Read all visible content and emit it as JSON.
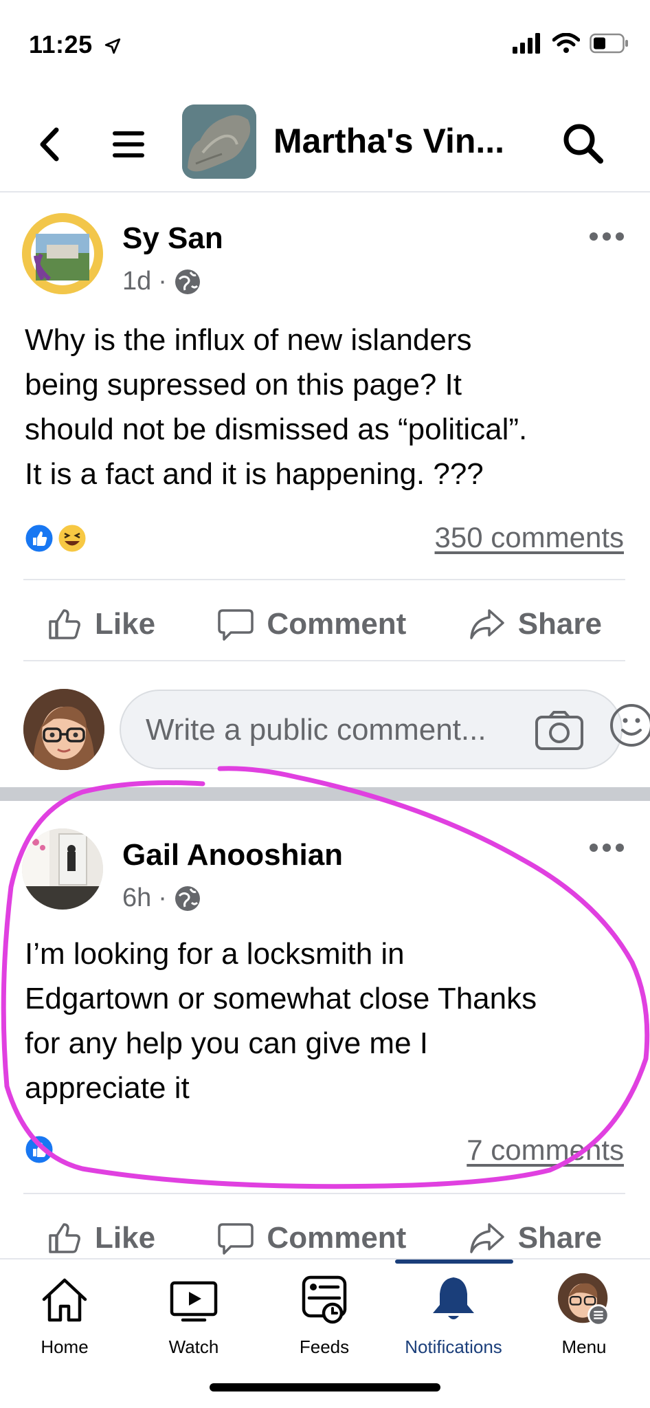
{
  "status_bar": {
    "time": "11:25"
  },
  "nav": {
    "title": "Martha's Vin..."
  },
  "posts": [
    {
      "author": "Sy San",
      "time": "1d",
      "text_lines": [
        "Why is the influx of new islanders",
        "being supressed on this page?  It",
        "should not be dismissed as “political”.",
        "It is a fact and it is happening.  ???"
      ],
      "comments": "350 comments",
      "actions": {
        "like": "Like",
        "comment": "Comment",
        "share": "Share"
      }
    },
    {
      "author": "Gail Anooshian",
      "time": "6h",
      "text_lines": [
        "I’m looking for a locksmith in",
        "Edgartown or somewhat close Thanks",
        "for any help you can give me I",
        "appreciate it"
      ],
      "comments": "7 comments",
      "actions": {
        "like": "Like",
        "comment": "Comment",
        "share": "Share"
      }
    }
  ],
  "composer": {
    "placeholder": "Write a public comment..."
  },
  "tabs": [
    {
      "label": "Home",
      "icon": "home-icon"
    },
    {
      "label": "Watch",
      "icon": "watch-icon"
    },
    {
      "label": "Feeds",
      "icon": "feeds-icon"
    },
    {
      "label": "Notifications",
      "icon": "bell-icon"
    },
    {
      "label": "Menu",
      "icon": "avatar"
    }
  ],
  "colors": {
    "accent": "#1a3e7a",
    "like_blue": "#1877f2",
    "highlight_magenta": "#e040e0",
    "muted_text": "#65676b"
  }
}
